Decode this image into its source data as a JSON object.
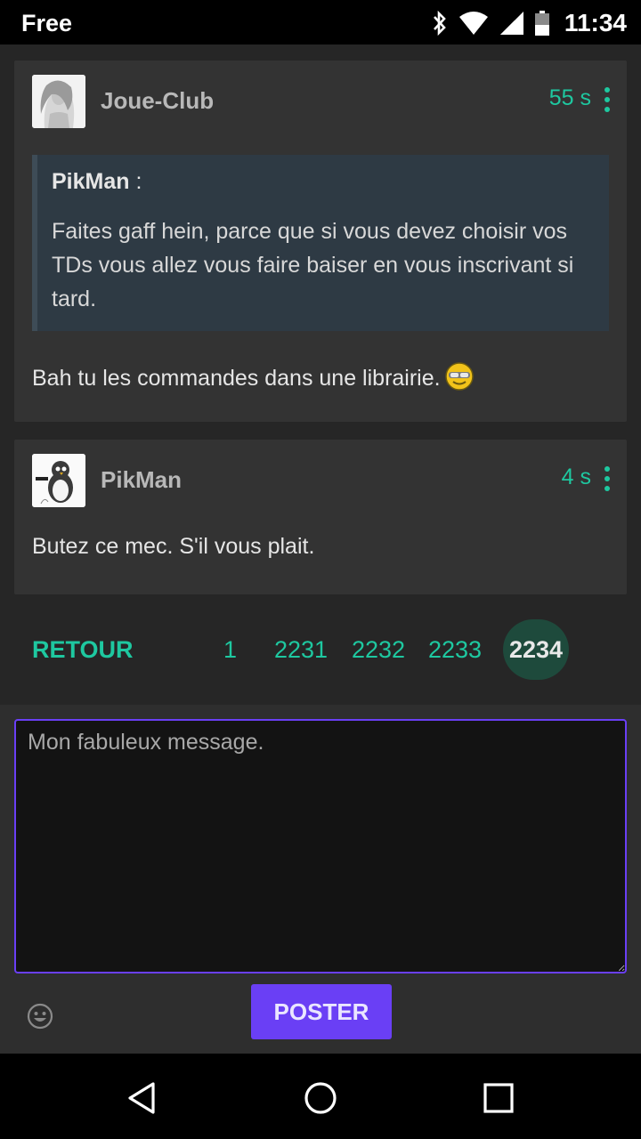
{
  "status_bar": {
    "carrier": "Free",
    "time": "11:34",
    "icons": [
      "bluetooth-icon",
      "wifi-icon",
      "signal-icon",
      "battery-icon"
    ]
  },
  "posts": [
    {
      "author": "Joue-Club",
      "time_ago": "55 s",
      "quote": {
        "author": "PikMan",
        "separator": " :",
        "text": "Faites gaff hein, parce que si vous devez choisir vos TDs vous allez vous faire baiser en vous inscrivant si tard."
      },
      "message": "Bah tu les commandes dans une librairie.",
      "smiley": "sunglasses-smiley-icon"
    },
    {
      "author": "PikMan",
      "time_ago": "4 s",
      "message": "Butez ce mec. S'il vous plait."
    }
  ],
  "pagination": {
    "back_label": "RETOUR",
    "pages": [
      "1",
      "2231",
      "2232",
      "2233"
    ],
    "current": "2234"
  },
  "compose": {
    "placeholder": "Mon fabuleux message.",
    "post_label": "POSTER"
  },
  "colors": {
    "accent": "#1ec8a0",
    "primary": "#6a3ff5",
    "card_bg": "#333333",
    "quote_bg": "#2e3a44"
  }
}
